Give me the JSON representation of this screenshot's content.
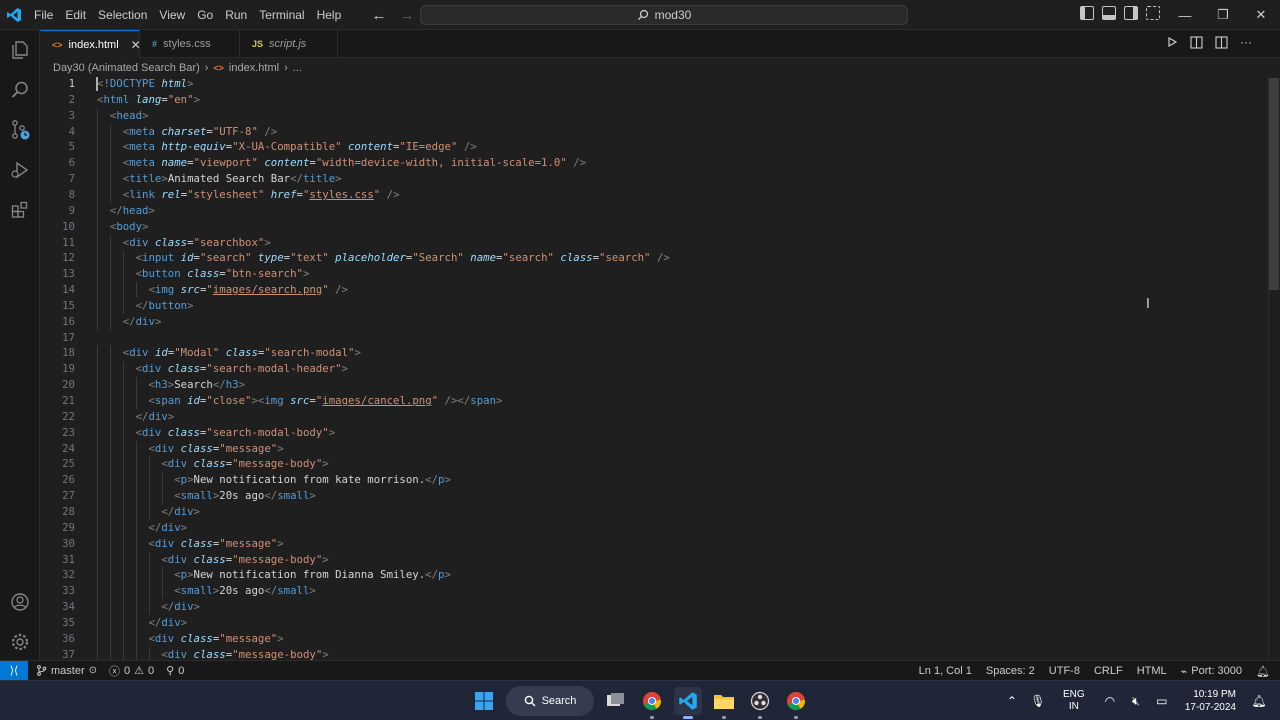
{
  "title_bar": {
    "menus": [
      "File",
      "Edit",
      "Selection",
      "View",
      "Go",
      "Run",
      "Terminal",
      "Help"
    ],
    "search_text": "mod30",
    "window_controls": [
      "minimize",
      "restore",
      "close"
    ]
  },
  "tabs": [
    {
      "ext": "<>",
      "label": "index.html",
      "active": true
    },
    {
      "ext": "#",
      "label": "styles.css",
      "active": false
    },
    {
      "ext": "JS",
      "label": "script.js",
      "active": false
    }
  ],
  "breadcrumb": {
    "folder": "Day30 (Animated Search Bar)",
    "file": "index.html",
    "more": "..."
  },
  "code_lines": [
    "<!DOCTYPE html>",
    "<html lang=\"en\">",
    "  <head>",
    "    <meta charset=\"UTF-8\" />",
    "    <meta http-equiv=\"X-UA-Compatible\" content=\"IE=edge\" />",
    "    <meta name=\"viewport\" content=\"width=device-width, initial-scale=1.0\" />",
    "    <title>Animated Search Bar</title>",
    "    <link rel=\"stylesheet\" href=\"styles.css\" />",
    "  </head>",
    "  <body>",
    "    <div class=\"searchbox\">",
    "      <input id=\"search\" type=\"text\" placeholder=\"Search\" name=\"search\" class=\"search\" />",
    "      <button class=\"btn-search\">",
    "        <img src=\"images/search.png\" />",
    "      </button>",
    "    </div>",
    "",
    "    <div id=\"Modal\" class=\"search-modal\">",
    "      <div class=\"search-modal-header\">",
    "        <h3>Search</h3>",
    "        <span id=\"close\"><img src=\"images/cancel.png\" /></span>",
    "      </div>",
    "      <div class=\"search-modal-body\">",
    "        <div class=\"message\">",
    "          <div class=\"message-body\">",
    "            <p>New notification from kate morrison.</p>",
    "            <small>20s ago</small>",
    "          </div>",
    "        </div>",
    "        <div class=\"message\">",
    "          <div class=\"message-body\">",
    "            <p>New notification from Dianna Smiley.</p>",
    "            <small>20s ago</small>",
    "          </div>",
    "        </div>",
    "        <div class=\"message\">",
    "          <div class=\"message-body\">"
  ],
  "status_bar": {
    "branch": "master",
    "errors": "0",
    "warnings": "0",
    "ports": "0",
    "position": "Ln 1, Col 1",
    "spaces": "Spaces: 2",
    "encoding": "UTF-8",
    "eol": "CRLF",
    "language": "HTML",
    "port": "Port: 3000"
  },
  "taskbar": {
    "search_label": "Search",
    "lang_line1": "ENG",
    "lang_line2": "IN",
    "time": "10:19 PM",
    "date": "17-07-2024"
  },
  "colors": {
    "accent": "#0078d4",
    "tag": "#569cd6",
    "attribute": "#9cdcfe",
    "string": "#ce9178",
    "text": "#d4d4d4"
  }
}
